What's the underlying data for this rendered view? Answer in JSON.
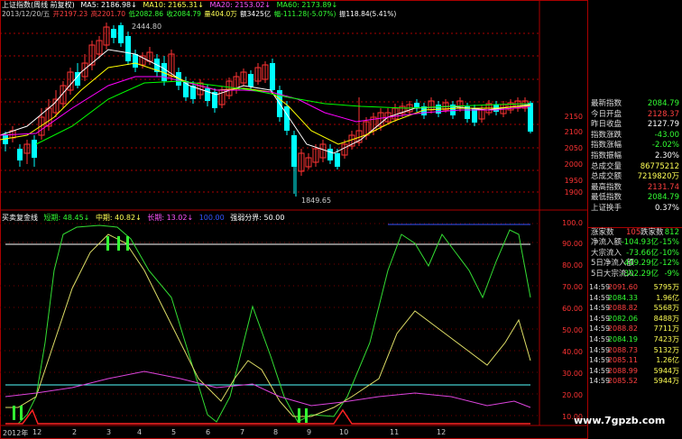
{
  "header": {
    "title": "上证指数(周线 前复权)",
    "ma5": "MA5: 2186.98↓",
    "ma10": "MA10: 2165.31↓",
    "ma20": "MA20: 2153.02↓",
    "ma60": "MA60: 2173.89↓",
    "date": "2013/12/20/五",
    "open": "开2197.23",
    "high": "高2201.70",
    "low": "低2082.86",
    "close": "收2084.79",
    "volume": "量404.0万",
    "amount": "额3425亿",
    "change": "幅-111.28(-5.07%)",
    "swing": "振118.84(5.41%)"
  },
  "indicator_header": {
    "name": "买卖复金线",
    "short": "短期: 48.45↓",
    "mid": "中期: 40.82↓",
    "long": "长期: 13.02↓",
    "val100": "100.00",
    "strong": "强弱分界: 50.00"
  },
  "price_annotations": {
    "high": "2444.80",
    "low": "1849.65"
  },
  "price_axis": [
    "2150",
    "2100",
    "2050",
    "2000",
    "1950",
    "1900"
  ],
  "indicator_axis": [
    "100.0",
    "90.00",
    "80.00",
    "70.00",
    "60.00",
    "50.00",
    "40.00",
    "30.00",
    "20.00",
    "10.00"
  ],
  "x_labels": [
    "2012年",
    "12",
    "2",
    "3",
    "4",
    "5",
    "6",
    "7",
    "8",
    "9",
    "10",
    "11",
    "12"
  ],
  "colors": {
    "ma5": "#ffffff",
    "ma10": "#ffff00",
    "ma20": "#ff00ff",
    "ma60": "#00ff00",
    "up": "#ff3333",
    "down": "#00ffff"
  },
  "stats": [
    {
      "label": "最新指数",
      "value": "2084.79",
      "color": "green"
    },
    {
      "label": "今日开盘",
      "value": "2128.37",
      "color": "red"
    },
    {
      "label": "昨日收盘",
      "value": "2127.79",
      "color": "white"
    },
    {
      "label": "指数涨跌",
      "value": "-43.00",
      "color": "green"
    },
    {
      "label": "指数涨幅",
      "value": "-2.02%",
      "color": "green"
    },
    {
      "label": "指数振幅",
      "value": "2.30%",
      "color": "white"
    },
    {
      "label": "总成交量",
      "value": "86775212",
      "color": "yellow"
    },
    {
      "label": "总成交额",
      "value": "7219820万",
      "color": "yellow"
    },
    {
      "label": "最高指数",
      "value": "2131.74",
      "color": "red"
    },
    {
      "label": "最低指数",
      "value": "2084.79",
      "color": "green"
    },
    {
      "label": "上证换手",
      "value": "0.37%",
      "color": "white"
    }
  ],
  "breadth": {
    "up_label": "涨家数",
    "up": "105",
    "down_label": "跌家数",
    "down": "812"
  },
  "flows": [
    {
      "label": "净流入额",
      "value": "-104.93亿",
      "pct": "-15%"
    },
    {
      "label": "大宗流入",
      "value": "-73.66亿",
      "pct": "-10%"
    },
    {
      "label": "5日净流入额",
      "value": "409.29亿",
      "pct": "-12%"
    },
    {
      "label": "5日大宗流入",
      "value": "-302.29亿",
      "pct": "-9%"
    }
  ],
  "ticks": [
    {
      "time": "14:59",
      "price": "2091.60",
      "vol": "5795万"
    },
    {
      "time": "14:59",
      "price": "2084.33",
      "vol": "1.96亿"
    },
    {
      "time": "14:59",
      "price": "2088.82",
      "vol": "5568万"
    },
    {
      "time": "14:59",
      "price": "2082.06",
      "vol": "8488万"
    },
    {
      "time": "14:59",
      "price": "2088.82",
      "vol": "7711万"
    },
    {
      "time": "14:59",
      "price": "2084.19",
      "vol": "7423万"
    },
    {
      "time": "14:59",
      "price": "2088.73",
      "vol": "5132万"
    },
    {
      "time": "14:59",
      "price": "2085.11",
      "vol": "1.26亿"
    },
    {
      "time": "14:59",
      "price": "2088.99",
      "vol": "5944万"
    },
    {
      "time": "14:59",
      "price": "2085.52",
      "vol": "5944万"
    }
  ],
  "watermark": "www.7gpzb.com"
}
